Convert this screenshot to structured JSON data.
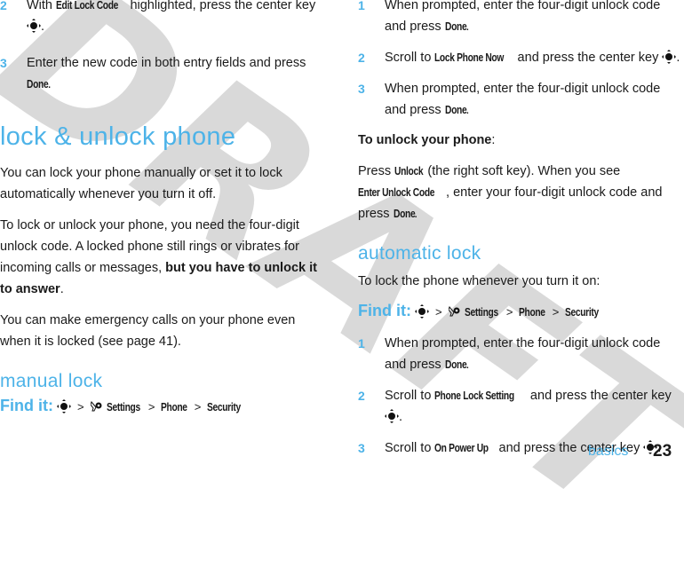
{
  "watermark": "DRAFT",
  "left_column": {
    "steps_top": [
      {
        "num": "2",
        "pre": "With ",
        "kw": "Edit Lock Code",
        "post": " highlighted, press the center key",
        "end": "."
      },
      {
        "num": "3",
        "pre": "Enter the new code in both entry fields and press ",
        "kw": "Done",
        "post": ".",
        "end": ""
      }
    ],
    "heading": "lock & unlock phone",
    "para1": "You can lock your phone manually or set it to lock automatically whenever you turn it off.",
    "para2_pre": "To lock or unlock your phone, you need the four-digit unlock code. A locked phone still rings or vibrates for incoming calls or messages, ",
    "para2_bold": "but you have to unlock it to answer",
    "para2_post": ".",
    "para3": "You can make emergency calls on your phone even when it is locked (see page 41).",
    "subheading": "manual lock",
    "find_it": {
      "label": "Find it:",
      "path": [
        "Settings",
        "Phone",
        "Security"
      ],
      "sep": ">"
    }
  },
  "right_column": {
    "steps_manual": [
      {
        "num": "1",
        "pre": "When prompted, enter the four-digit unlock code and press ",
        "kw": "Done",
        "post": "."
      },
      {
        "num": "2",
        "pre": "Scroll to ",
        "kw": "Lock Phone Now",
        "post": " and press the center key",
        "end": "."
      },
      {
        "num": "3",
        "pre": "When prompted, enter the four-digit unlock code and press ",
        "kw": "Done",
        "post": "."
      }
    ],
    "unlock_heading": "To unlock your phone",
    "unlock_colon": ":",
    "unlock_para": {
      "t1": "Press ",
      "kw1": "Unlock",
      "t2": " (the right soft key). When you see ",
      "kw2": "Enter Unlock Code",
      "t3": ", enter your four-digit unlock code and press ",
      "kw3": "Done",
      "t4": "."
    },
    "subheading": "automatic lock",
    "auto_intro": "To lock the phone whenever you turn it on:",
    "find_it": {
      "label": "Find it:",
      "path": [
        "Settings",
        "Phone",
        "Security"
      ],
      "sep": ">"
    },
    "steps_auto": [
      {
        "num": "1",
        "pre": "When prompted, enter the four-digit unlock code and press ",
        "kw": "Done",
        "post": "."
      },
      {
        "num": "2",
        "pre": "Scroll to ",
        "kw": "Phone Lock Setting",
        "post": " and press the center key",
        "end": "."
      },
      {
        "num": "3",
        "pre": "Scroll to ",
        "kw": "On Power Up",
        "post": " and press the center key",
        "end": "."
      }
    ]
  },
  "footer": {
    "section": "basics",
    "page": "23"
  },
  "colors": {
    "accent": "#4db3e8",
    "text": "#1a1a1a",
    "watermark": "#d9d9d9"
  },
  "icons": {
    "center_key": "nav-center-key-icon",
    "settings": "settings-gear-wrench-icon"
  }
}
